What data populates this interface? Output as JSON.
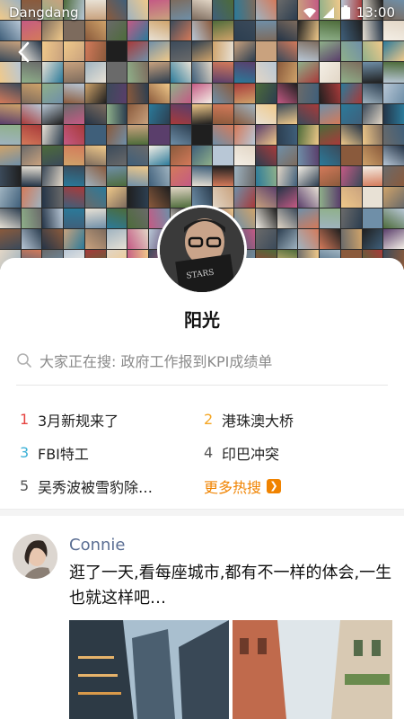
{
  "status_bar": {
    "carrier": "Dangdang",
    "time": "13:00"
  },
  "profile": {
    "name": "阳光"
  },
  "search": {
    "placeholder": "大家正在搜: 政府工作报到KPI成绩单"
  },
  "hot_searches": {
    "items": [
      {
        "rank": "1",
        "text": "3月新规来了",
        "rank_color": "#e64340"
      },
      {
        "rank": "2",
        "text": "港珠澳大桥",
        "rank_color": "#f5a623"
      },
      {
        "rank": "3",
        "text": "FBI特工",
        "rank_color": "#3bb0d6"
      },
      {
        "rank": "4",
        "text": "印巴冲突",
        "rank_color": "#555555"
      },
      {
        "rank": "5",
        "text": "吴秀波被雪豹除…",
        "rank_color": "#555555"
      }
    ],
    "more_label": "更多热搜"
  },
  "post": {
    "author": "Connie",
    "text": "逛了一天,看每座城市,都有不一样的体会,一生也就这样吧…"
  },
  "colors": {
    "accent_orange": "#f08300",
    "author_blue": "#5a6e93"
  }
}
